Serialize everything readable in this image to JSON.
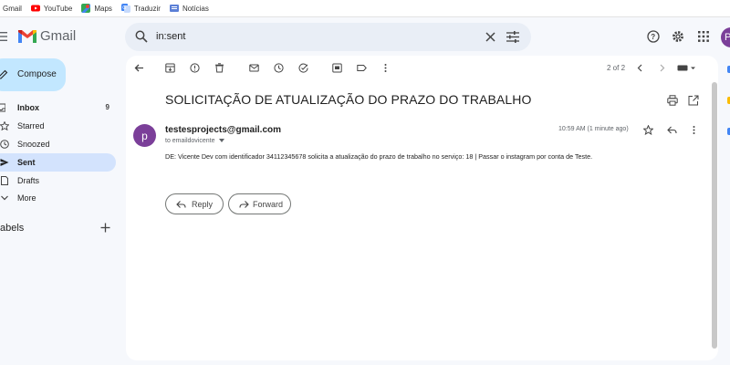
{
  "bookmarks": [
    {
      "label": "Gmail",
      "icon": "gmail-icon",
      "color": "#ffffff"
    },
    {
      "label": "YouTube",
      "icon": "youtube-icon",
      "color": "#ff0000"
    },
    {
      "label": "Maps",
      "icon": "maps-icon",
      "color": "#34a853"
    },
    {
      "label": "Traduzir",
      "icon": "translate-icon",
      "color": "#4285f4"
    },
    {
      "label": "Notícias",
      "icon": "news-icon",
      "color": "#5b7fd6"
    }
  ],
  "header": {
    "brand": "Gmail",
    "search_value": "in:sent",
    "avatar_letter": "P"
  },
  "sidebar": {
    "compose_label": "Compose",
    "items": [
      {
        "label": "Inbox",
        "count": "9",
        "icon": "inbox-icon",
        "active": false
      },
      {
        "label": "Starred",
        "count": "",
        "icon": "star-icon",
        "active": false
      },
      {
        "label": "Snoozed",
        "count": "",
        "icon": "clock-icon",
        "active": false
      },
      {
        "label": "Sent",
        "count": "",
        "icon": "send-icon",
        "active": true
      },
      {
        "label": "Drafts",
        "count": "",
        "icon": "draft-icon",
        "active": false
      },
      {
        "label": "More",
        "count": "",
        "icon": "chevron-down-icon",
        "active": false
      }
    ],
    "labels_header": "abels"
  },
  "toolbar": {
    "pager": "2 of 2"
  },
  "message": {
    "subject": "SOLICITAÇÃO DE ATUALIZAÇÃO DO PRAZO DO TRABALHO",
    "sender_avatar": "p",
    "sender": "testesprojects@gmail.com",
    "to_line": "to emaildovicente",
    "time": "10:59 AM (1 minute ago)",
    "body": "DE: Vicente Dev com identificador 34112345678 solicita a atualização do prazo de trabalho no serviço: 18 | Passar o instagram por conta de Teste.",
    "reply_label": "Reply",
    "forward_label": "Forward"
  },
  "colors": {
    "accent": "#d3e3fd",
    "compose_bg": "#c2e7ff",
    "avatar": "#7b3f99",
    "search_bg": "#e9eef6",
    "page_bg": "#f6f8fc"
  }
}
